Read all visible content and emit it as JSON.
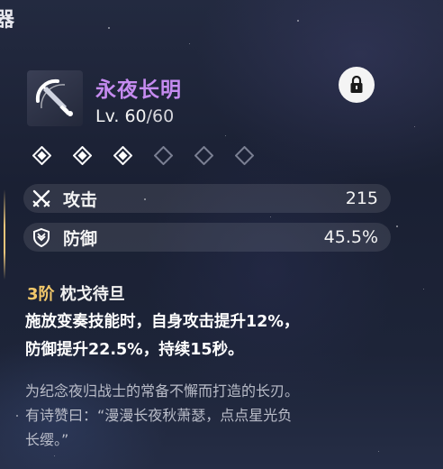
{
  "corner_glyph": "器",
  "weapon": {
    "name": "永夜长明",
    "level_prefix": "Lv. ",
    "level_current": "60",
    "level_max": "/60",
    "icon": "sword-icon",
    "locked": true
  },
  "ranks": {
    "total": 6,
    "filled": 3
  },
  "stats": [
    {
      "icon": "crossed-swords-icon",
      "label": "攻击",
      "value": "215"
    },
    {
      "icon": "shield-icon",
      "label": "防御",
      "value": "45.5%"
    }
  ],
  "passive": {
    "rank": "3阶",
    "name": " 枕戈待旦",
    "desc_lines": [
      "施放变奏技能时，自身攻击提升12%，",
      "防御提升22.5%，持续15秒。"
    ]
  },
  "lore_lines": [
    "为纪念夜归战士的常备不懈而打造的长刃。",
    "有诗赞曰：“漫漫长夜秋萧瑟，点点星光负",
    "长缨。”"
  ],
  "colors": {
    "title": "#c58bf0",
    "rank_accent": "#f2c86a",
    "lore": "#b9bcc8"
  }
}
